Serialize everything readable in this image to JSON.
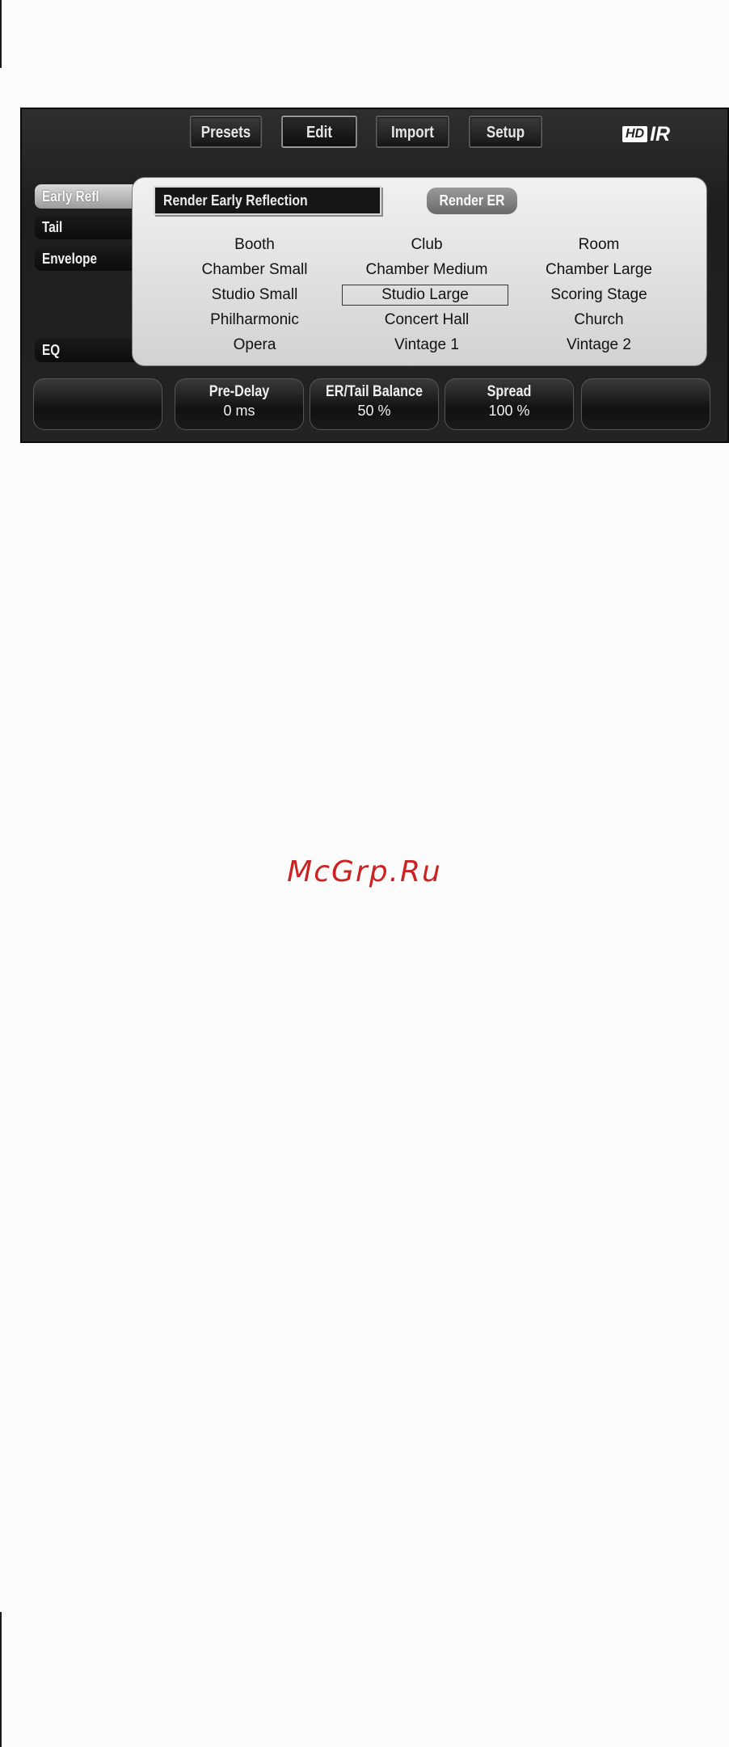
{
  "topbar": {
    "buttons": [
      {
        "label": "Presets"
      },
      {
        "label": "Edit"
      },
      {
        "label": "Import"
      },
      {
        "label": "Setup"
      }
    ],
    "logo": {
      "hd": "HD",
      "ir": "IR"
    }
  },
  "sidebar": {
    "tabs": [
      {
        "label": "Early Refl"
      },
      {
        "label": "Tail"
      },
      {
        "label": "Envelope"
      },
      {
        "label": "EQ"
      }
    ]
  },
  "panel": {
    "render_label": "Render Early Reflection",
    "render_button": "Render ER",
    "rooms": [
      [
        "Booth",
        "Club",
        "Room"
      ],
      [
        "Chamber Small",
        "Chamber Medium",
        "Chamber Large"
      ],
      [
        "Studio Small",
        "Studio Large",
        "Scoring Stage"
      ],
      [
        "Philharmonic",
        "Concert Hall",
        "Church"
      ],
      [
        "Opera",
        "Vintage 1",
        "Vintage 2"
      ]
    ],
    "selected_room": "Studio Large"
  },
  "controls": [
    {
      "title": "Pre-Delay",
      "value": "0 ms"
    },
    {
      "title": "ER/Tail Balance",
      "value": "50 %"
    },
    {
      "title": "Spread",
      "value": "100 %"
    }
  ],
  "watermark": "McGrp.Ru"
}
